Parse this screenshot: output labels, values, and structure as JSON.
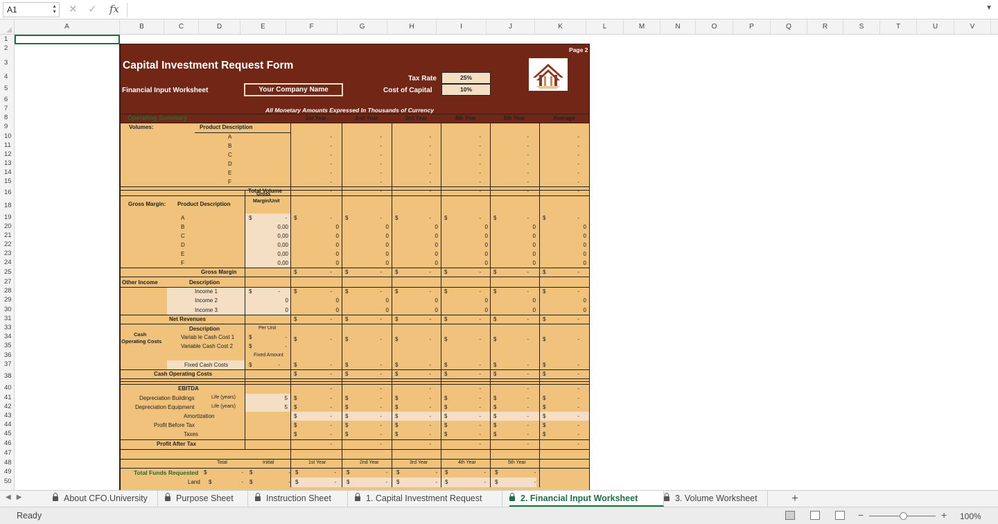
{
  "formula_bar": {
    "cell_ref": "A1",
    "fx": "fx",
    "content": ""
  },
  "columns": [
    "A",
    "B",
    "C",
    "D",
    "E",
    "F",
    "G",
    "H",
    "I",
    "J",
    "K",
    "L",
    "M",
    "N",
    "O",
    "P",
    "Q",
    "R",
    "S",
    "T",
    "U",
    "V"
  ],
  "rows": [
    "1",
    "2",
    "3",
    "4",
    "5",
    "6",
    "7",
    "8",
    "9",
    "10",
    "11",
    "12",
    "13",
    "14",
    "15",
    "16",
    "18",
    "19",
    "20",
    "21",
    "22",
    "23",
    "24",
    "25",
    "27",
    "28",
    "29",
    "30",
    "31",
    "33",
    "34",
    "35",
    "36",
    "37",
    "38",
    "40",
    "41",
    "42",
    "43",
    "44",
    "45",
    "46",
    "47",
    "48",
    "49",
    "50"
  ],
  "form": {
    "page": "Page 2",
    "title": "Capital Investment Request Form",
    "subtitle": "Financial Input Worksheet",
    "company": "Your Company Name",
    "tax_rate_label": "Tax Rate",
    "tax_rate": "25%",
    "cost_capital_label": "Cost of Capital",
    "cost_capital": "10%",
    "note": "All Monetary Amounts Expressed In Thousands of Currency",
    "operating_summary": "Operating Summary",
    "year_headers": [
      "1st Year",
      "2nd Year",
      "3rd Year",
      "4th Year",
      "5th Year",
      "Average"
    ],
    "volumes": "Volumes:",
    "product_description": "Product Description",
    "products": [
      "A",
      "B",
      "C",
      "D",
      "E",
      "F"
    ],
    "total_volume": "Total Volume",
    "gross_margin_section": "Gross Margin:",
    "gm_product_description": "Product Description",
    "gm_unit_header_1": "Gross",
    "gm_unit_header_2": "Margin/Unit",
    "gm_unit_values": [
      "0,00",
      "0,00",
      "0,00",
      "0,00",
      "0,00"
    ],
    "gross_margin_total": "Gross Margin",
    "other_income": "Other Income",
    "description": "Description",
    "incomes": [
      "Income 1",
      "Income 2",
      "Income 3"
    ],
    "net_revenues": "Net Revenues",
    "cash_1": "Cash",
    "cash_2": "Operating   Costs",
    "per_unit": "Per Unit",
    "variable_costs": [
      "Variab le Cash Cost 1",
      "Variable Cash Cost 2"
    ],
    "fixed_amount": "Fixed Amount",
    "fixed_cash_costs": "Fixed Cash Costs",
    "cash_operating_costs": "Cash Operating Costs",
    "ebitda": "EBITDA",
    "dep_buildings": "Depreciation Buildings",
    "dep_equipment": "Depreciation Equipment",
    "life_years": "Life (years)",
    "life_values": [
      "5",
      "5"
    ],
    "amortization": "Amortization",
    "profit_before_tax": "Profit Before Tax",
    "taxes": "Taxes",
    "profit_after_tax": "Profit After Tax",
    "funds_headers": [
      "Total",
      "Initial",
      "1st Year",
      "2nd Year",
      "3rd Year",
      "4th Year",
      "5th Year"
    ],
    "total_funds": "Total Funds Requested",
    "land": "Land",
    "dash": "-",
    "dollar": "$",
    "zero": "0"
  },
  "sheet_tabs": [
    {
      "label": "About CFO.University",
      "active": false
    },
    {
      "label": "Purpose Sheet",
      "active": false
    },
    {
      "label": "Instruction Sheet",
      "active": false
    },
    {
      "label": "1. Capital Investment Request",
      "active": false
    },
    {
      "label": "2. Financial Input Worksheet",
      "active": true
    },
    {
      "label": "3. Volume Worksheet",
      "active": false
    }
  ],
  "add_sheet": "+",
  "status": "Ready",
  "zoom": "100%",
  "colors": {
    "header": "#722716",
    "body": "#f0c27b",
    "light": "#f5dfc4",
    "accent": "#1e7145"
  }
}
